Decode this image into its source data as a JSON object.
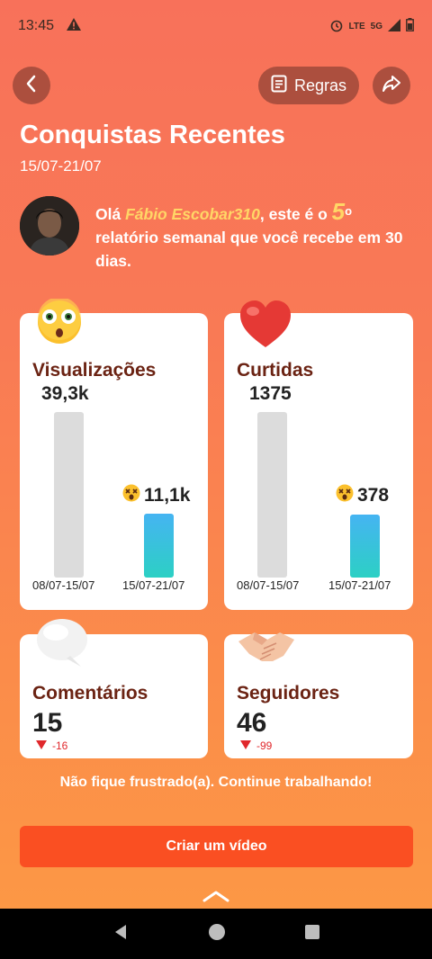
{
  "status_bar": {
    "time": "13:45",
    "network_lte": "LTE",
    "network_5g": "5G"
  },
  "header": {
    "rules_label": "Regras"
  },
  "title": "Conquistas Recentes",
  "date_range": "15/07-21/07",
  "greeting": {
    "prefix": "Olá ",
    "username": "Fábio Escobar310",
    "middle": ", este é o ",
    "number": "5",
    "ordinal": "o",
    "suffix": "relatório semanal que você recebe em 30 dias."
  },
  "cards": {
    "views": {
      "title": "Visualizações",
      "previous_value": "39,3k",
      "current_value": "11,1k",
      "previous_label": "08/07-15/07",
      "current_label": "15/07-21/07"
    },
    "likes": {
      "title": "Curtidas",
      "previous_value": "1375",
      "current_value": "378",
      "previous_label": "08/07-15/07",
      "current_label": "15/07-21/07"
    },
    "comments": {
      "title": "Comentários",
      "value": "15",
      "delta": "-16"
    },
    "followers": {
      "title": "Seguidores",
      "value": "46",
      "delta": "-99"
    }
  },
  "motivation": "Não fique frustrado(a). Continue trabalhando!",
  "cta_label": "Criar um vídeo",
  "colors": {
    "accent": "#fa4f22",
    "card_title": "#6b2313",
    "highlight": "#ffd666",
    "delta_down": "#e0282c"
  }
}
